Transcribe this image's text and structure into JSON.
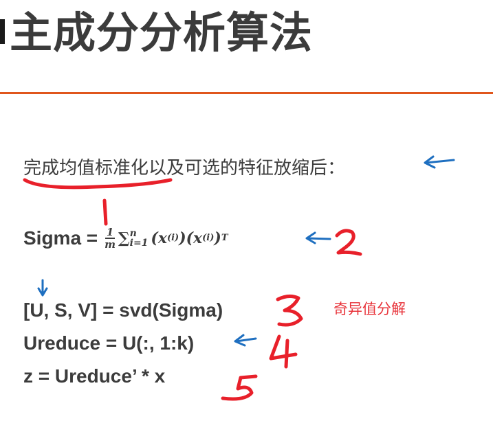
{
  "title": "主成分分析算法",
  "intro": "完成均值标准化以及可选的特征放缩后：",
  "formulas": {
    "sigma_label": "Sigma =",
    "frac_num": "1",
    "frac_den": "m",
    "sum_symbol": "∑",
    "sum_upper": "n",
    "sum_lower": "i=1",
    "term1": "(x",
    "term1_sup": "(i)",
    "term1_close": ")",
    "term2": "(x",
    "term2_sup": "(i)",
    "term2_close": ")",
    "term2_sup2": "T",
    "svd": "[U, S, V] = svd(Sigma)",
    "ureduce": "Ureduce = U(:, 1:k)",
    "z": "z = Ureduce’ * x"
  },
  "annotations": {
    "note": "奇异值分解",
    "marks": [
      "1",
      "2",
      "3",
      "4",
      "5"
    ]
  },
  "colors": {
    "accent_rule": "#e0561c",
    "red_ink": "#e8202a",
    "blue_ink": "#1e6fc0",
    "text": "#3c3c3c"
  }
}
